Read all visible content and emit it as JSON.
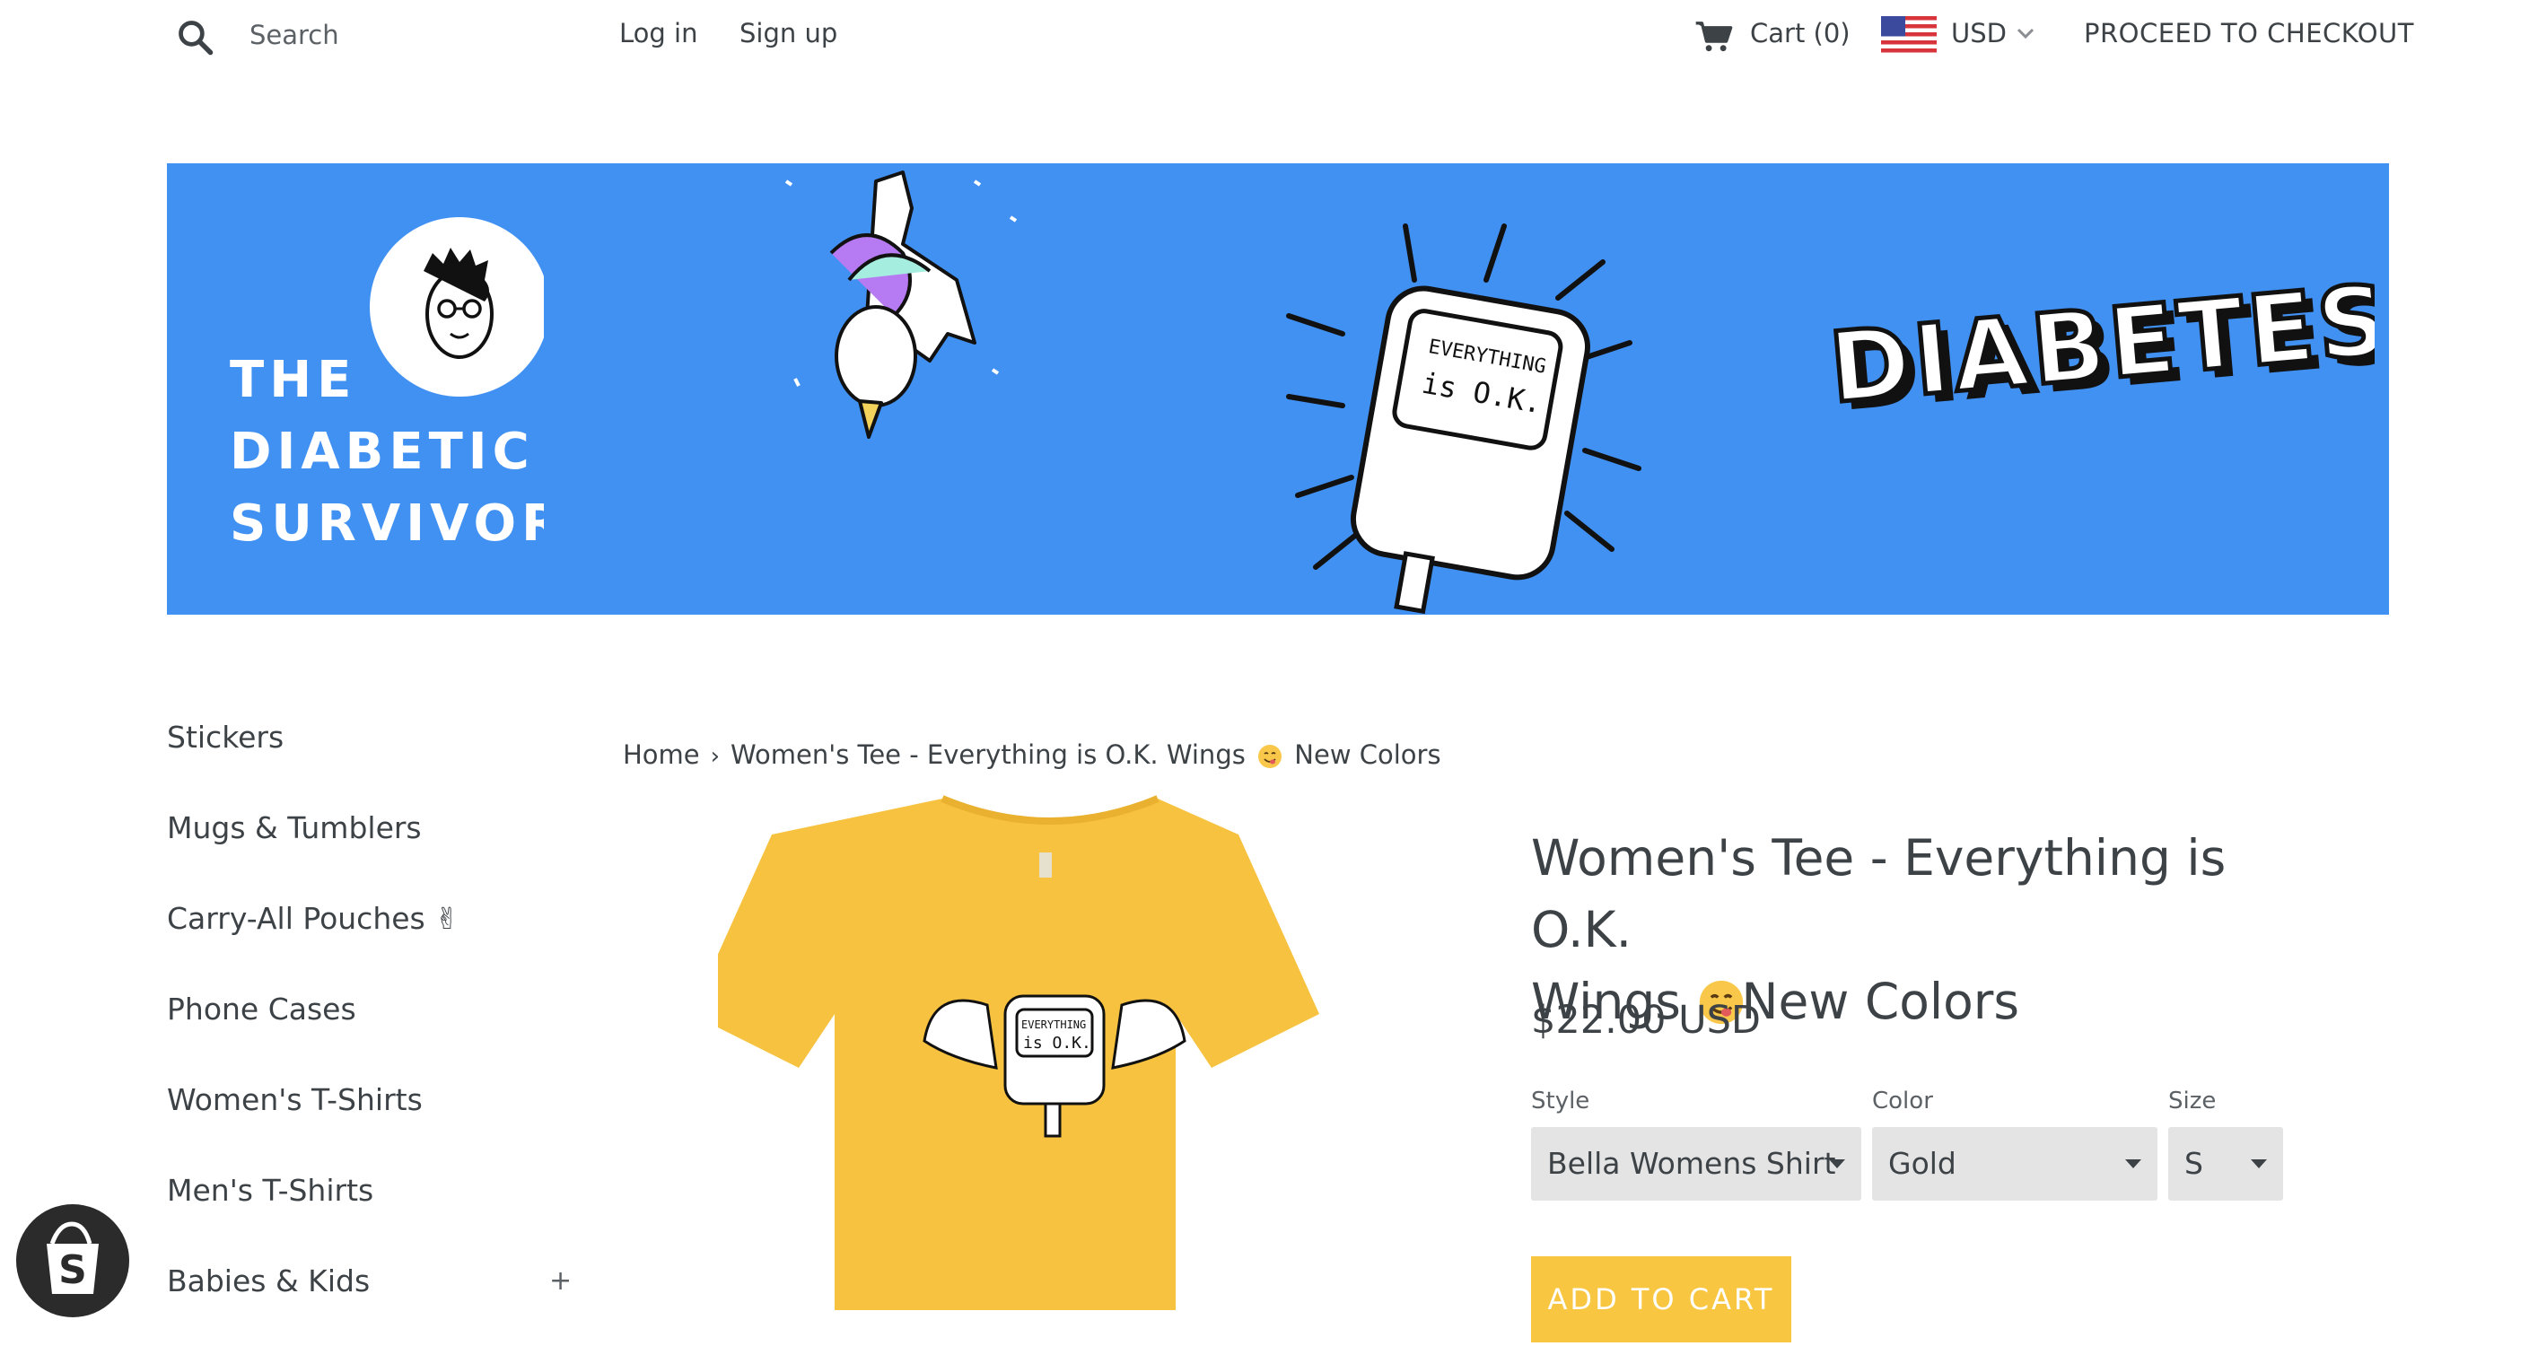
{
  "header": {
    "search_label": "Search",
    "login": "Log in",
    "signup": "Sign up",
    "cart": "Cart (0)",
    "currency": "USD",
    "checkout": "PROCEED TO CHECKOUT"
  },
  "banner": {
    "brand_lines": [
      "THE",
      "DIABETIC",
      "SURVIVOR"
    ],
    "meter_lines": [
      "EVERYTHING",
      "is O.K."
    ],
    "word": "DIABETES"
  },
  "sidebar": {
    "items": [
      {
        "label": "Stickers"
      },
      {
        "label": "Mugs & Tumblers"
      },
      {
        "label": "Carry-All Pouches ✌"
      },
      {
        "label": "Phone Cases"
      },
      {
        "label": "Women's T-Shirts"
      },
      {
        "label": "Men's T-Shirts"
      },
      {
        "label": "Babies & Kids"
      }
    ],
    "expand_symbol": "+"
  },
  "breadcrumb": {
    "home": "Home",
    "separator": "›",
    "current_before": "Women's Tee - Everything is O.K. Wings",
    "current_after": "New Colors"
  },
  "product": {
    "title_line1": "Women's Tee - Everything is O.K.",
    "title_line2_before": "Wings",
    "title_line2_after": "New Colors",
    "price": "$22.00 USD",
    "options": {
      "style": {
        "label": "Style",
        "value": "Bella Womens Shirt"
      },
      "color": {
        "label": "Color",
        "value": "Gold"
      },
      "size": {
        "label": "Size",
        "value": "S"
      }
    },
    "add_to_cart": "ADD TO CART",
    "print_text": [
      "EVERYTHING",
      "is O.K."
    ]
  },
  "colors": {
    "banner_blue": "#4191f3",
    "shirt_gold": "#f7c23f",
    "button_gold": "#f8c640",
    "text": "#3d4246"
  }
}
